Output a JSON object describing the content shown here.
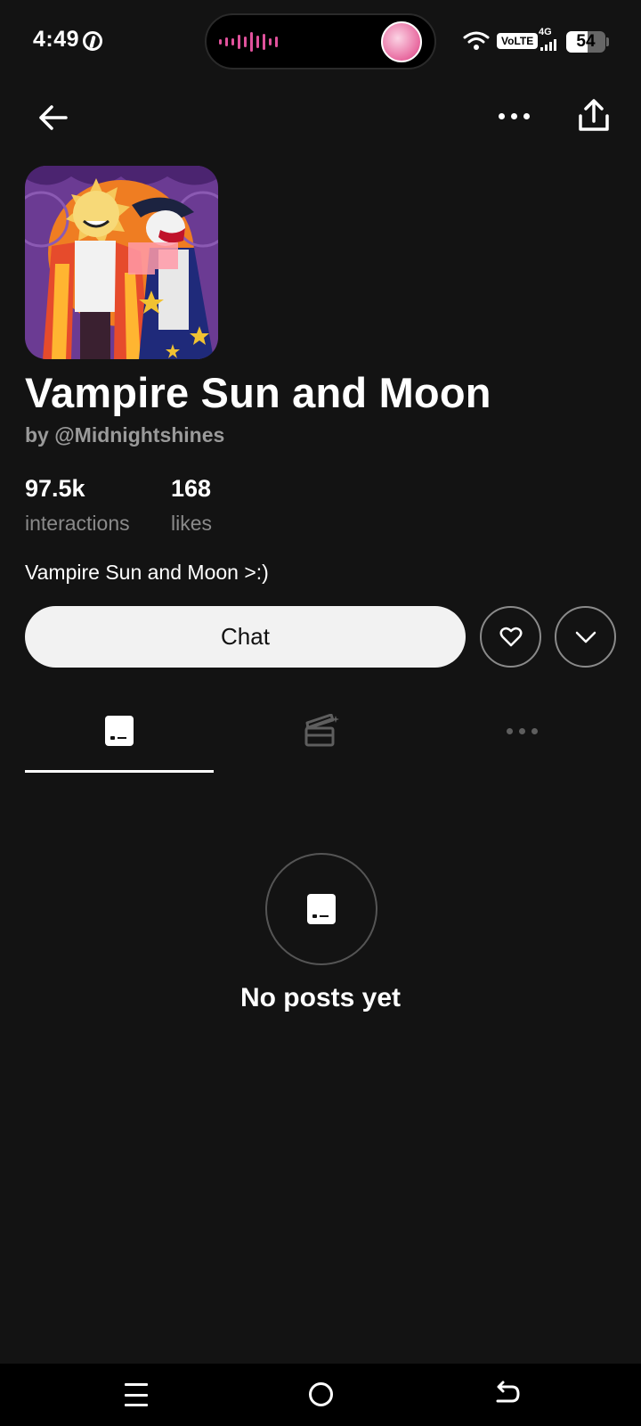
{
  "status_bar": {
    "time": "4:49",
    "network_badge": "VoLTE",
    "network_type": "4G",
    "battery_percent": "54"
  },
  "icons": {
    "back": "arrow-left-icon",
    "more": "more-horizontal-icon",
    "share": "share-icon",
    "heart": "heart-icon",
    "expand": "chevron-down-icon",
    "posts": "posts-icon",
    "scenes": "clapperboard-icon"
  },
  "character": {
    "name": "Vampire Sun and Moon",
    "author": "by @Midnightshines",
    "stats": [
      {
        "value": "97.5k",
        "label": "interactions"
      },
      {
        "value": "168",
        "label": "likes"
      }
    ],
    "description": "Vampire Sun and Moon >:)"
  },
  "actions": {
    "chat_label": "Chat"
  },
  "empty_state": {
    "text": "No posts yet"
  },
  "colors": {
    "background": "#131313",
    "chat_button": "#f2f2f2",
    "cover_purple": "#6b3b93",
    "cover_orange": "#ef7d22"
  }
}
